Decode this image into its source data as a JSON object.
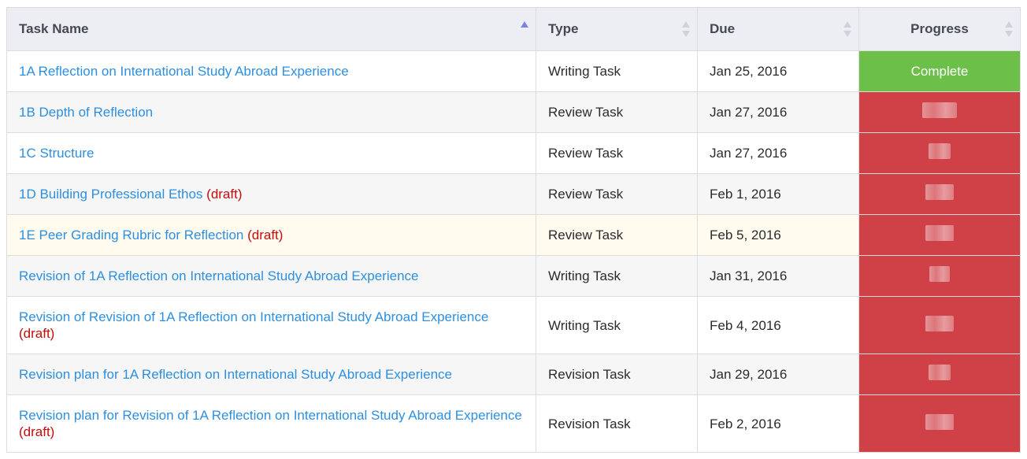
{
  "table": {
    "columns": [
      {
        "label": "Task Name",
        "sort": "ascending"
      },
      {
        "label": "Type",
        "sort": "none"
      },
      {
        "label": "Due",
        "sort": "none"
      },
      {
        "label": "Progress",
        "sort": "none"
      }
    ],
    "rows": [
      {
        "name": "1A Reflection on International Study Abroad Experience",
        "draft": "",
        "type": "Writing Task",
        "due": "Jan 25, 2016",
        "progress": "Complete",
        "status": "complete"
      },
      {
        "name": "1B Depth of Reflection",
        "draft": "",
        "type": "Review Task",
        "due": "Jan 27, 2016",
        "progress": "",
        "status": "incomplete"
      },
      {
        "name": "1C Structure",
        "draft": "",
        "type": "Review Task",
        "due": "Jan 27, 2016",
        "progress": "",
        "status": "incomplete"
      },
      {
        "name": "1D Building Professional Ethos",
        "draft": "(draft)",
        "type": "Review Task",
        "due": "Feb 1, 2016",
        "progress": "",
        "status": "incomplete"
      },
      {
        "name": "1E Peer Grading Rubric for Reflection",
        "draft": "(draft)",
        "type": "Review Task",
        "due": "Feb 5, 2016",
        "progress": "",
        "status": "incomplete"
      },
      {
        "name": "Revision of 1A Reflection on International Study Abroad Experience",
        "draft": "",
        "type": "Writing Task",
        "due": "Jan 31, 2016",
        "progress": "",
        "status": "incomplete"
      },
      {
        "name": "Revision of Revision of 1A Reflection on International Study Abroad Experience",
        "draft": "(draft)",
        "type": "Writing Task",
        "due": "Feb 4, 2016",
        "progress": "",
        "status": "incomplete"
      },
      {
        "name": "Revision plan for 1A Reflection on International Study Abroad Experience",
        "draft": "",
        "type": "Revision Task",
        "due": "Jan 29, 2016",
        "progress": "",
        "status": "incomplete"
      },
      {
        "name": "Revision plan for Revision of 1A Reflection on International Study Abroad Experience",
        "draft": "(draft)",
        "type": "Revision Task",
        "due": "Feb 2, 2016",
        "progress": "",
        "status": "incomplete"
      }
    ]
  },
  "colors": {
    "link": "#2d8fe0",
    "draft": "#c40c0c",
    "complete": "#6cc04a",
    "incomplete": "#cf4047",
    "header_bg": "#eceef4",
    "highlight_row": "#fffbee"
  }
}
